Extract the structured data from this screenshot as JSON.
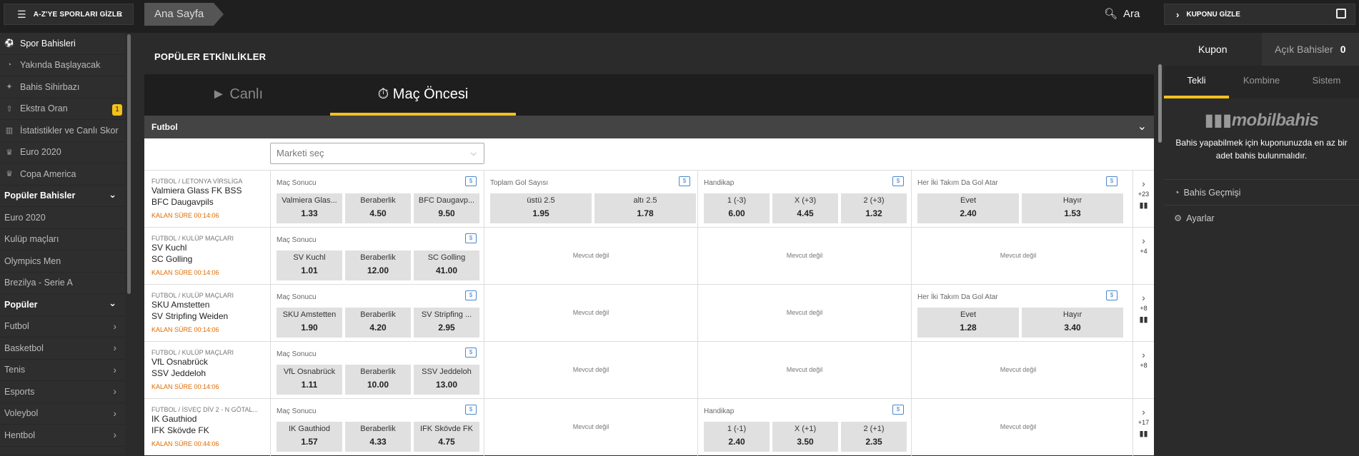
{
  "topbar": {
    "az_label": "A-Z'YE SPORLARI GİZLE",
    "breadcrumb": "Ana Sayfa",
    "search_label": "Ara",
    "coupon_hide_label": "KUPONU GİZLE"
  },
  "sidebar": {
    "items": [
      {
        "label": "Spor Bahisleri",
        "icon": "soccer-ball-icon"
      },
      {
        "label": "Yakında Başlayacak",
        "icon": "clock-icon"
      },
      {
        "label": "Bahis Sihirbazı",
        "icon": "wand-icon"
      },
      {
        "label": "Ekstra Oran",
        "icon": "boost-icon",
        "badge": "1"
      },
      {
        "label": "İstatistikler ve Canlı Skor",
        "icon": "stats-icon"
      },
      {
        "label": "Euro 2020",
        "icon": "trophy-icon"
      },
      {
        "label": "Copa America",
        "icon": "trophy-icon"
      }
    ],
    "popular_bets_header": "Popüler Bahisler",
    "popular_bets": [
      "Euro 2020",
      "Kulüp maçları",
      "Olympics Men",
      "Brezilya - Serie A"
    ],
    "popular_header": "Popüler",
    "popular": [
      "Futbol",
      "Basketbol",
      "Tenis",
      "Esports",
      "Voleybol",
      "Hentbol"
    ]
  },
  "main": {
    "title": "POPÜLER ETKİNLİKLER",
    "tabs": [
      {
        "label": "Canlı"
      },
      {
        "label": "Maç Öncesi"
      }
    ],
    "sport": "Futbol",
    "market_select_placeholder": "Marketi seç",
    "not_available": "Mevcut değil",
    "events": [
      {
        "league": "FUTBOL / LETONYA VİRSLİGA",
        "home": "Valmiera Glass FK BSS",
        "away": "BFC Daugavpils",
        "time": "KALAN SÜRE 00:14:06",
        "more": "+23",
        "markets": [
          {
            "title": "Maç Sonucu",
            "odds": [
              {
                "n": "Valmiera Glas...",
                "v": "1.33"
              },
              {
                "n": "Beraberlik",
                "v": "4.50"
              },
              {
                "n": "BFC Daugavp...",
                "v": "9.50"
              }
            ]
          },
          {
            "title": "Toplam Gol Sayısı",
            "odds": [
              {
                "n": "üstü 2.5",
                "v": "1.95"
              },
              {
                "n": "altı 2.5",
                "v": "1.78"
              }
            ]
          },
          {
            "title": "Handikap",
            "odds": [
              {
                "n": "1 (-3)",
                "v": "6.00"
              },
              {
                "n": "X (+3)",
                "v": "4.45"
              },
              {
                "n": "2 (+3)",
                "v": "1.32"
              }
            ]
          },
          {
            "title": "Her İki Takım Da Gol Atar",
            "odds": [
              {
                "n": "Evet",
                "v": "2.40"
              },
              {
                "n": "Hayır",
                "v": "1.53"
              }
            ]
          }
        ]
      },
      {
        "league": "FUTBOL / KULÜP MAÇLARI",
        "home": "SV Kuchl",
        "away": "SC Golling",
        "time": "KALAN SÜRE 00:14:06",
        "more": "+4",
        "markets": [
          {
            "title": "Maç Sonucu",
            "odds": [
              {
                "n": "SV Kuchl",
                "v": "1.01"
              },
              {
                "n": "Beraberlik",
                "v": "12.00"
              },
              {
                "n": "SC Golling",
                "v": "41.00"
              }
            ]
          },
          null,
          null,
          null
        ]
      },
      {
        "league": "FUTBOL / KULÜP MAÇLARI",
        "home": "SKU Amstetten",
        "away": "SV Stripfing Weiden",
        "time": "KALAN SÜRE 00:14:06",
        "more": "+8",
        "markets": [
          {
            "title": "Maç Sonucu",
            "odds": [
              {
                "n": "SKU Amstetten",
                "v": "1.90"
              },
              {
                "n": "Beraberlik",
                "v": "4.20"
              },
              {
                "n": "SV Stripfing ...",
                "v": "2.95"
              }
            ]
          },
          null,
          null,
          {
            "title": "Her İki Takım Da Gol Atar",
            "odds": [
              {
                "n": "Evet",
                "v": "1.28"
              },
              {
                "n": "Hayır",
                "v": "3.40"
              }
            ]
          }
        ]
      },
      {
        "league": "FUTBOL / KULÜP MAÇLARI",
        "home": "VfL Osnabrück",
        "away": "SSV Jeddeloh",
        "time": "KALAN SÜRE 00:14:06",
        "more": "+8",
        "markets": [
          {
            "title": "Maç Sonucu",
            "odds": [
              {
                "n": "VfL Osnabrück",
                "v": "1.11"
              },
              {
                "n": "Beraberlik",
                "v": "10.00"
              },
              {
                "n": "SSV Jeddeloh",
                "v": "13.00"
              }
            ]
          },
          null,
          null,
          null
        ]
      },
      {
        "league": "FUTBOL / İSVEÇ DİV 2 - N GÖTAL...",
        "home": "IK Gauthiod",
        "away": "IFK Skövde FK",
        "time": "KALAN SÜRE 00:44:06",
        "more": "+17",
        "markets": [
          {
            "title": "Maç Sonucu",
            "odds": [
              {
                "n": "IK Gauthiod",
                "v": "1.57"
              },
              {
                "n": "Beraberlik",
                "v": "4.33"
              },
              {
                "n": "IFK Skövde FK",
                "v": "4.75"
              }
            ]
          },
          null,
          {
            "title": "Handikap",
            "odds": [
              {
                "n": "1 (-1)",
                "v": "2.40"
              },
              {
                "n": "X (+1)",
                "v": "3.50"
              },
              {
                "n": "2 (+1)",
                "v": "2.35"
              }
            ]
          },
          null
        ]
      }
    ]
  },
  "coupon": {
    "tab_coupon": "Kupon",
    "tab_open": "Açık Bahisler",
    "open_count": "0",
    "subtabs": [
      "Tekli",
      "Kombine",
      "Sistem"
    ],
    "logo": "mobilbahis",
    "message": "Bahis yapabilmek için kuponunuzda en az bir adet bahis bulunmalıdır.",
    "history": "Bahis Geçmişi",
    "settings": "Ayarlar"
  },
  "colors": {
    "accent": "#f4c11b",
    "time": "#e06a00",
    "stat_icon": "#4a88c9"
  }
}
